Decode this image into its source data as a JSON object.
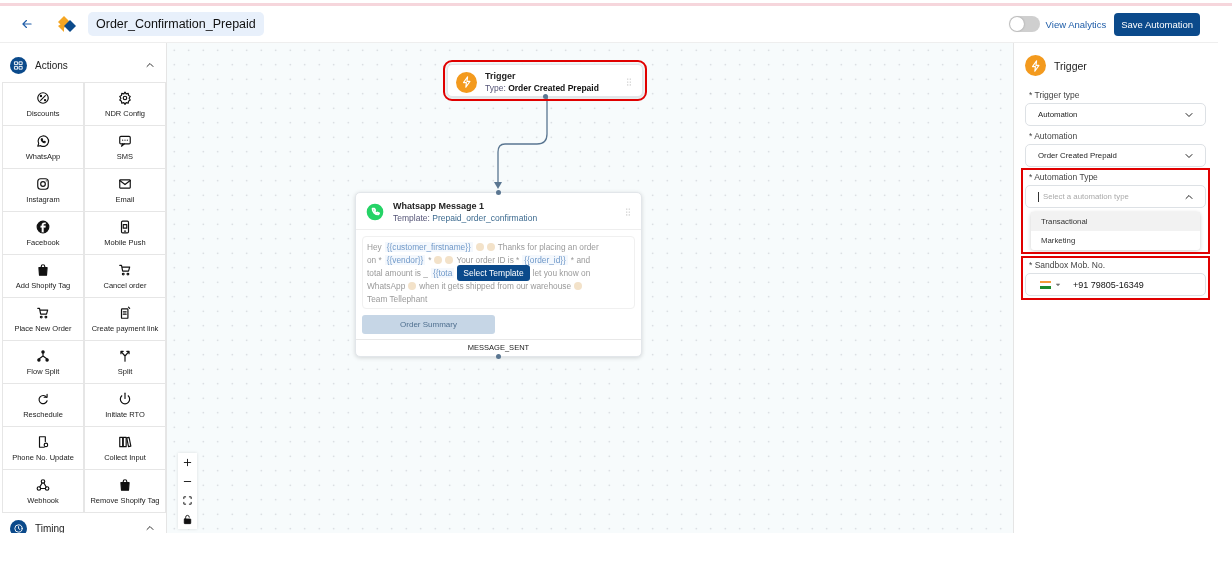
{
  "header": {
    "title": "Order_Confirmation_Prepaid",
    "analytics_toggle": {
      "label": "View Analytics",
      "on": false
    },
    "save_button": "Save Automation"
  },
  "sidebar": {
    "sections": [
      {
        "title": "Actions",
        "expanded": true,
        "items": [
          {
            "label": "Discounts",
            "kind": "percent"
          },
          {
            "label": "NDR Config",
            "kind": "gear"
          },
          {
            "label": "WhatsApp",
            "kind": "whatsapp"
          },
          {
            "label": "SMS",
            "kind": "chat"
          },
          {
            "label": "Instagram",
            "kind": "instagram"
          },
          {
            "label": "Email",
            "kind": "mail"
          },
          {
            "label": "Facebook",
            "kind": "facebook"
          },
          {
            "label": "Mobile Push",
            "kind": "phone"
          },
          {
            "label": "Add Shopify Tag",
            "kind": "bag"
          },
          {
            "label": "Cancel order",
            "kind": "cartx"
          },
          {
            "label": "Place New Order",
            "kind": "cart"
          },
          {
            "label": "Create payment link",
            "kind": "receipt"
          },
          {
            "label": "Flow Split",
            "kind": "tree"
          },
          {
            "label": "Split",
            "kind": "fork"
          },
          {
            "label": "Reschedule",
            "kind": "redo"
          },
          {
            "label": "Initiate RTO",
            "kind": "power"
          },
          {
            "label": "Phone No. Update",
            "kind": "phonegear"
          },
          {
            "label": "Collect Input",
            "kind": "books"
          },
          {
            "label": "Webhook",
            "kind": "webhook"
          },
          {
            "label": "Remove Shopify Tag",
            "kind": "bag"
          }
        ]
      },
      {
        "title": "Timing",
        "expanded": true
      }
    ]
  },
  "canvas": {
    "nodes": [
      {
        "kind": "trigger",
        "title": "Trigger",
        "subtitle_label": "Type:",
        "subtitle_value": "Order Created Prepaid",
        "highlighted": true
      },
      {
        "kind": "whatsapp",
        "title": "Whatsapp Message 1",
        "subtitle_label": "Template:",
        "subtitle_value": "Prepaid_order_confirmation",
        "message_lines": [
          [
            {
              "kind": "text",
              "text": "Hey"
            },
            {
              "kind": "variable",
              "text": "{{customer_firstname}}"
            },
            {
              "kind": "emoji"
            },
            {
              "kind": "emoji"
            },
            {
              "kind": "text",
              "text": "Thanks for placing an order"
            }
          ],
          [
            {
              "kind": "text",
              "text": "on *"
            },
            {
              "kind": "variable",
              "text": "{{vendor}}"
            },
            {
              "kind": "text",
              "text": "*"
            },
            {
              "kind": "emoji"
            },
            {
              "kind": "emoji"
            },
            {
              "kind": "text",
              "text": "Your order ID is *"
            },
            {
              "kind": "variable",
              "text": "{{order_id}}"
            },
            {
              "kind": "text",
              "text": "* and"
            }
          ],
          [
            {
              "kind": "text",
              "text": "total amount is _"
            },
            {
              "kind": "variable",
              "text": "{{tota"
            },
            {
              "kind": "button",
              "text": "Select Template"
            },
            {
              "kind": "text",
              "text": "let you know on"
            }
          ],
          [
            {
              "kind": "text",
              "text": "WhatsApp"
            },
            {
              "kind": "emoji"
            },
            {
              "kind": "text",
              "text": "when it gets shipped from our warehouse"
            },
            {
              "kind": "emoji"
            }
          ],
          [
            {
              "kind": "text",
              "text": "Team Tellephant"
            }
          ]
        ],
        "action_button": "Order Summary",
        "output": "MESSAGE_SENT"
      }
    ],
    "controls": [
      {
        "kind": "zoom-in"
      },
      {
        "kind": "zoom-out"
      },
      {
        "kind": "fit"
      },
      {
        "kind": "lock"
      }
    ]
  },
  "panel": {
    "title": "Trigger",
    "fields": [
      {
        "kind": "select",
        "label": "* Trigger type",
        "value": "Automation",
        "expanded": false
      },
      {
        "kind": "select",
        "label": "* Automation",
        "value": "Order Created Prepaid",
        "expanded": false
      },
      {
        "kind": "select",
        "label": "* Automation Type",
        "placeholder": "Select a automation type",
        "expanded": true,
        "highlighted": true,
        "options": [
          {
            "label": "Transactional",
            "selected": true
          },
          {
            "label": "Marketing",
            "selected": false
          }
        ]
      },
      {
        "kind": "phone",
        "label": "* Sandbox Mob. No.",
        "value": "+91 79805-16349",
        "highlighted": true
      }
    ]
  }
}
